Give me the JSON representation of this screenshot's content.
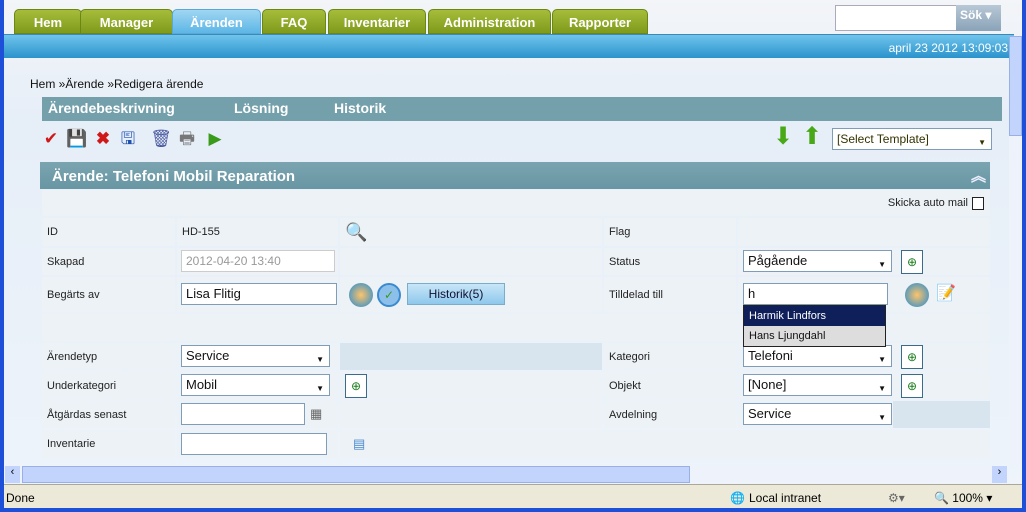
{
  "nav_tabs": [
    {
      "label": "Hem"
    },
    {
      "label": "Manager"
    },
    {
      "label": "Ärenden",
      "active": true
    },
    {
      "label": "FAQ"
    },
    {
      "label": "Inventarier"
    },
    {
      "label": "Administration"
    },
    {
      "label": "Rapporter"
    }
  ],
  "search": {
    "value": "",
    "button": "Sök"
  },
  "datetime": "april 23 2012 13:09:03",
  "breadcrumb": {
    "items": [
      "Hem »",
      "Ärende »",
      "Redigera ärende"
    ]
  },
  "subtabs": [
    "Ärendebeskrivning",
    "Lösning",
    "Historik"
  ],
  "toolbar": {
    "icons": [
      "save-close-icon",
      "save-icon",
      "delete-x-icon",
      "save-cancel-icon",
      "trash-icon",
      "print-icon",
      "export-icon"
    ],
    "template_select": "[Select Template]"
  },
  "section": {
    "title": "Ärende: Telefoni Mobil Reparation"
  },
  "form": {
    "auto_mail_label": "Skicka auto mail",
    "id_label": "ID",
    "id_value": "HD-155",
    "flag_label": "Flag",
    "skapad_label": "Skapad",
    "skapad_value": "2012-04-20 13:40",
    "status_label": "Status",
    "status_value": "Pågående",
    "begarts_label": "Begärts av",
    "begarts_value": "Lisa Flitig",
    "historik_button": "Historik(5)",
    "tilldelad_label": "Tilldelad till",
    "tilldelad_value": "h",
    "suggestions": [
      "Harmik Lindfors",
      "Hans Ljungdahl"
    ],
    "arendetyp_label": "Ärendetyp",
    "arendetyp_value": "Service",
    "kategori_label": "Kategori",
    "kategori_value": "Telefoni",
    "underkategori_label": "Underkategori",
    "underkategori_value": "Mobil",
    "objekt_label": "Objekt",
    "objekt_value": "[None]",
    "atgardas_label": "Åtgärdas senast",
    "atgardas_value": "",
    "avdelning_label": "Avdelning",
    "avdelning_value": "Service",
    "inventarie_label": "Inventarie",
    "inventarie_value": ""
  },
  "statusbar": {
    "text": "Done",
    "zone": "Local intranet",
    "zoom": "100%"
  }
}
